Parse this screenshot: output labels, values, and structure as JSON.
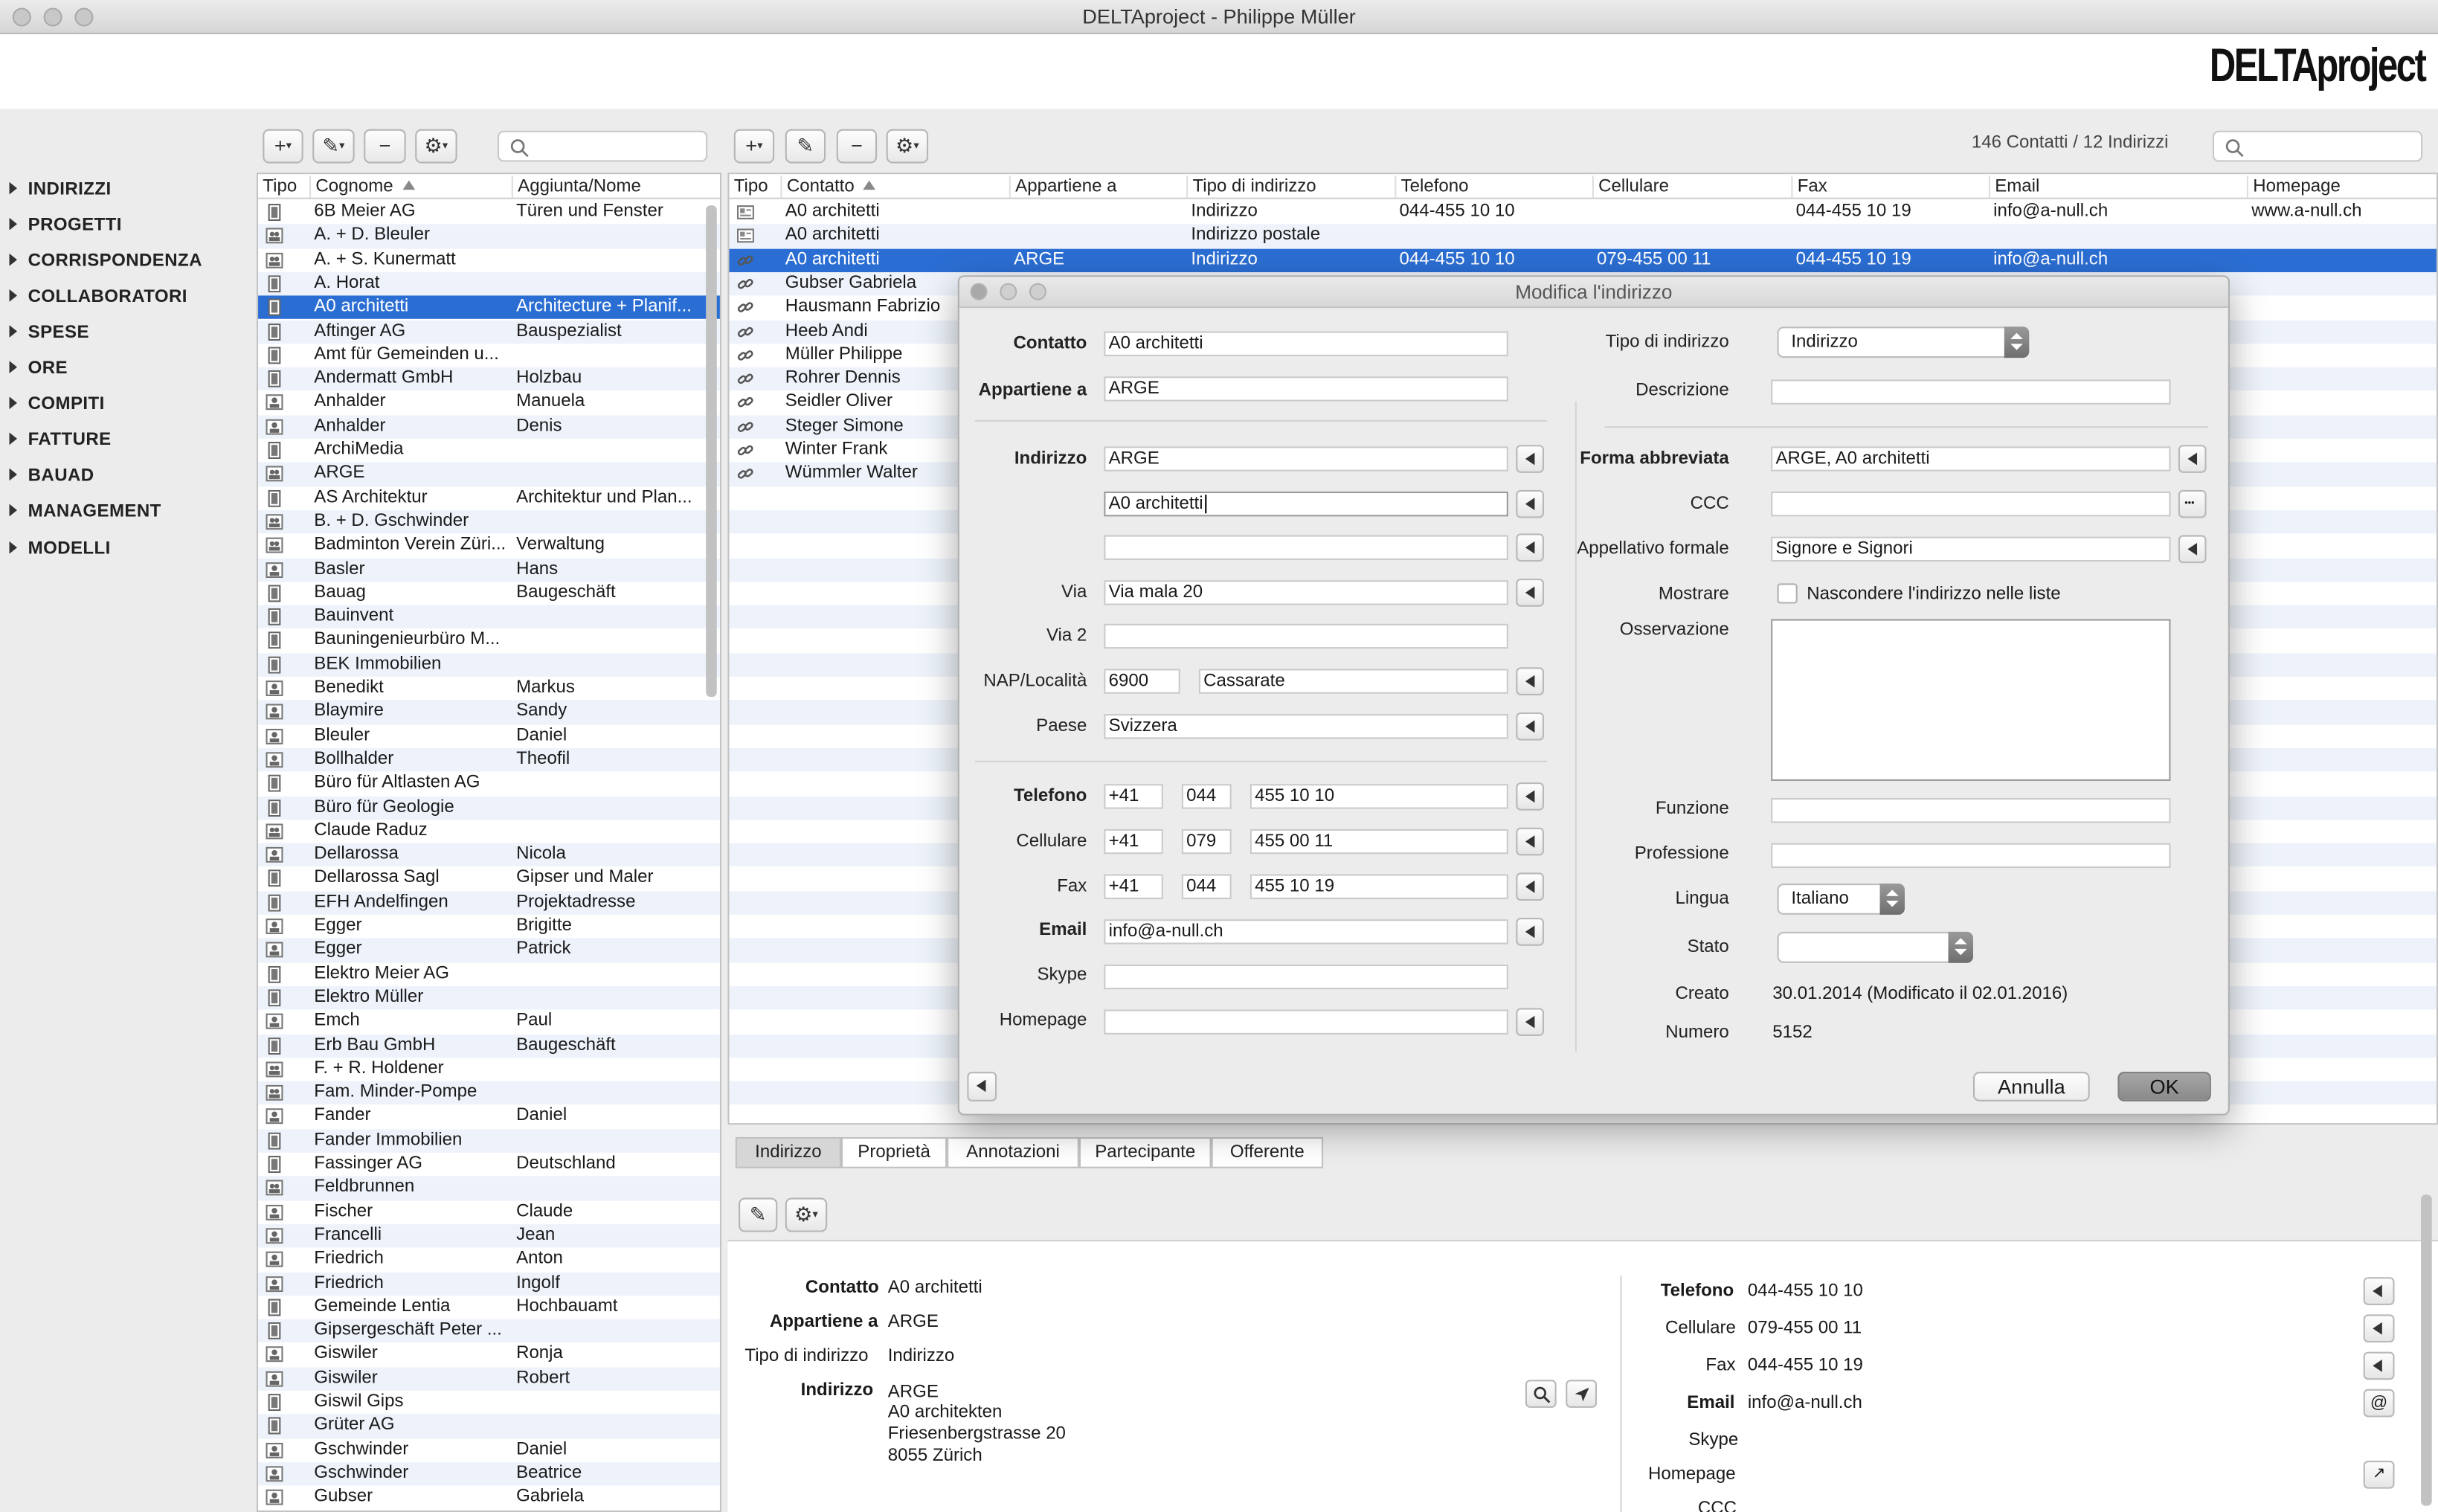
{
  "window": {
    "title": "DELTAproject - Philippe Müller",
    "logo": "DELTAproject"
  },
  "toolbar": {
    "counts": "146 Contatti / 12 Indirizzi",
    "search_left_placeholder": "",
    "search_right_placeholder": ""
  },
  "sidebar": {
    "items": [
      "INDIRIZZI",
      "PROGETTI",
      "CORRISPONDENZA",
      "COLLABORATORI",
      "SPESE",
      "ORE",
      "COMPITI",
      "FATTURE",
      "BAUAD",
      "MANAGEMENT",
      "MODELLI"
    ]
  },
  "left_table": {
    "headers": [
      "Tipo",
      "Cognome",
      "Aggiunta/Nome"
    ],
    "rows": [
      {
        "t": "c",
        "n": "6B Meier AG",
        "a": "Türen und Fenster"
      },
      {
        "t": "g",
        "n": "A. + D. Bleuler",
        "a": ""
      },
      {
        "t": "g",
        "n": "A. + S. Kunermatt",
        "a": ""
      },
      {
        "t": "c",
        "n": "A. Horat",
        "a": ""
      },
      {
        "t": "c",
        "n": "A0 architetti",
        "a": "Architecture + Planif...",
        "sel": true
      },
      {
        "t": "c",
        "n": "Aftinger AG",
        "a": "Bauspezialist"
      },
      {
        "t": "c",
        "n": "Amt für Gemeinden u...",
        "a": ""
      },
      {
        "t": "c",
        "n": "Andermatt GmbH",
        "a": "Holzbau"
      },
      {
        "t": "p",
        "n": "Anhalder",
        "a": "Manuela"
      },
      {
        "t": "p",
        "n": "Anhalder",
        "a": "Denis"
      },
      {
        "t": "c",
        "n": "ArchiMedia",
        "a": ""
      },
      {
        "t": "g",
        "n": "ARGE",
        "a": ""
      },
      {
        "t": "c",
        "n": "AS Architektur",
        "a": "Architektur und Plan..."
      },
      {
        "t": "g",
        "n": "B. + D. Gschwinder",
        "a": ""
      },
      {
        "t": "g",
        "n": "Badminton Verein Züri...",
        "a": "Verwaltung"
      },
      {
        "t": "p",
        "n": "Basler",
        "a": "Hans"
      },
      {
        "t": "c",
        "n": "Bauag",
        "a": "Baugeschäft"
      },
      {
        "t": "c",
        "n": "Bauinvent",
        "a": ""
      },
      {
        "t": "c",
        "n": "Bauningenieurbüro M...",
        "a": ""
      },
      {
        "t": "c",
        "n": "BEK Immobilien",
        "a": ""
      },
      {
        "t": "p",
        "n": "Benedikt",
        "a": "Markus"
      },
      {
        "t": "p",
        "n": "Blaymire",
        "a": "Sandy"
      },
      {
        "t": "p",
        "n": "Bleuler",
        "a": "Daniel"
      },
      {
        "t": "p",
        "n": "Bollhalder",
        "a": "Theofil"
      },
      {
        "t": "c",
        "n": "Büro für Altlasten AG",
        "a": ""
      },
      {
        "t": "c",
        "n": "Büro für Geologie",
        "a": ""
      },
      {
        "t": "g",
        "n": "Claude Raduz",
        "a": ""
      },
      {
        "t": "p",
        "n": "Dellarossa",
        "a": "Nicola"
      },
      {
        "t": "c",
        "n": "Dellarossa Sagl",
        "a": "Gipser und Maler"
      },
      {
        "t": "c",
        "n": "EFH Andelfingen",
        "a": "Projektadresse"
      },
      {
        "t": "p",
        "n": "Egger",
        "a": "Brigitte"
      },
      {
        "t": "p",
        "n": "Egger",
        "a": "Patrick"
      },
      {
        "t": "c",
        "n": "Elektro Meier AG",
        "a": ""
      },
      {
        "t": "c",
        "n": "Elektro Müller",
        "a": ""
      },
      {
        "t": "p",
        "n": "Emch",
        "a": "Paul"
      },
      {
        "t": "c",
        "n": "Erb Bau GmbH",
        "a": "Baugeschäft"
      },
      {
        "t": "g",
        "n": "F. + R. Holdener",
        "a": ""
      },
      {
        "t": "g",
        "n": "Fam. Minder-Pompe",
        "a": ""
      },
      {
        "t": "p",
        "n": "Fander",
        "a": "Daniel"
      },
      {
        "t": "c",
        "n": "Fander Immobilien",
        "a": ""
      },
      {
        "t": "c",
        "n": "Fassinger AG",
        "a": "Deutschland"
      },
      {
        "t": "g",
        "n": "Feldbrunnen",
        "a": ""
      },
      {
        "t": "p",
        "n": "Fischer",
        "a": "Claude"
      },
      {
        "t": "p",
        "n": "Francelli",
        "a": "Jean"
      },
      {
        "t": "p",
        "n": "Friedrich",
        "a": "Anton"
      },
      {
        "t": "p",
        "n": "Friedrich",
        "a": "Ingolf"
      },
      {
        "t": "c",
        "n": "Gemeinde Lentia",
        "a": "Hochbauamt"
      },
      {
        "t": "c",
        "n": "Gipsergeschäft Peter ...",
        "a": ""
      },
      {
        "t": "p",
        "n": "Giswiler",
        "a": "Ronja"
      },
      {
        "t": "p",
        "n": "Giswiler",
        "a": "Robert"
      },
      {
        "t": "c",
        "n": "Giswil Gips",
        "a": ""
      },
      {
        "t": "c",
        "n": "Grüter AG",
        "a": ""
      },
      {
        "t": "p",
        "n": "Gschwinder",
        "a": "Daniel"
      },
      {
        "t": "p",
        "n": "Gschwinder",
        "a": "Beatrice"
      },
      {
        "t": "p",
        "n": "Gubser",
        "a": "Gabriela"
      }
    ]
  },
  "right_table": {
    "headers": [
      "Tipo",
      "Contatto",
      "Appartiene a",
      "Tipo di indirizzo",
      "Telefono",
      "Cellulare",
      "Fax",
      "Email",
      "Homepage"
    ],
    "rows": [
      {
        "t": "card",
        "c": "A0 architetti",
        "ap": "",
        "ti": "Indirizzo",
        "tel": "044-455 10 10",
        "cel": "",
        "fax": "044-455 10 19",
        "em": "info@a-null.ch",
        "hp": "www.a-null.ch"
      },
      {
        "t": "card",
        "c": "A0 architetti",
        "ap": "",
        "ti": "Indirizzo postale",
        "tel": "",
        "cel": "",
        "fax": "",
        "em": "",
        "hp": ""
      },
      {
        "t": "link",
        "c": "A0 architetti",
        "ap": "ARGE",
        "ti": "Indirizzo",
        "tel": "044-455 10 10",
        "cel": "079-455 00 11",
        "fax": "044-455 10 19",
        "em": "info@a-null.ch",
        "hp": "",
        "sel": true
      },
      {
        "t": "link",
        "c": "Gubser Gabriela"
      },
      {
        "t": "link",
        "c": "Hausmann Fabrizio"
      },
      {
        "t": "link",
        "c": "Heeb Andi"
      },
      {
        "t": "link",
        "c": "Müller Philippe"
      },
      {
        "t": "link",
        "c": "Rohrer Dennis"
      },
      {
        "t": "link",
        "c": "Seidler Oliver"
      },
      {
        "t": "link",
        "c": "Steger Simone"
      },
      {
        "t": "link",
        "c": "Winter Frank"
      },
      {
        "t": "link",
        "c": "Wümmler Walter"
      }
    ]
  },
  "dialog": {
    "title": "Modifica l'indirizzo",
    "labels": {
      "contatto": "Contatto",
      "appartiene": "Appartiene a",
      "indirizzo": "Indirizzo",
      "via": "Via",
      "via2": "Via 2",
      "nap": "NAP/Località",
      "paese": "Paese",
      "telefono": "Telefono",
      "cellulare": "Cellulare",
      "fax": "Fax",
      "email": "Email",
      "skype": "Skype",
      "homepage": "Homepage",
      "tipo": "Tipo di indirizzo",
      "descrizione": "Descrizione",
      "forma": "Forma abbreviata",
      "ccc": "CCC",
      "appellativo": "Appellativo formale",
      "mostrare": "Mostrare",
      "osservazione": "Osservazione",
      "funzione": "Funzione",
      "professione": "Professione",
      "lingua": "Lingua",
      "stato": "Stato",
      "creato": "Creato",
      "numero": "Numero"
    },
    "values": {
      "contatto": "A0 architetti",
      "appartiene": "ARGE",
      "ind1": "ARGE",
      "ind2": "A0 architetti",
      "ind3": "",
      "via": "Via mala 20",
      "via2": "",
      "nap": "6900",
      "localita": "Cassarate",
      "paese": "Svizzera",
      "tel_cc": "+41",
      "tel_area": "044",
      "tel_num": "455 10 10",
      "cel_cc": "+41",
      "cel_area": "079",
      "cel_num": "455 00 11",
      "fax_cc": "+41",
      "fax_area": "044",
      "fax_num": "455 10 19",
      "email": "info@a-null.ch",
      "skype": "",
      "homepage": "",
      "tipo": "Indirizzo",
      "descrizione": "",
      "forma": "ARGE, A0 architetti",
      "ccc": "",
      "appellativo": "Signore e Signori",
      "nascondere": "Nascondere l'indirizzo nelle liste",
      "osservazione": "",
      "funzione": "",
      "professione": "",
      "lingua": "Italiano",
      "stato": "",
      "creato": "30.01.2014 (Modificato il 02.01.2016)",
      "numero": "5152"
    },
    "buttons": {
      "cancel": "Annulla",
      "ok": "OK"
    }
  },
  "tabs": [
    "Indirizzo",
    "Proprietà",
    "Annotazioni",
    "Partecipante",
    "Offerente"
  ],
  "detail": {
    "labels": {
      "contatto": "Contatto",
      "appartiene": "Appartiene a",
      "tipo": "Tipo di indirizzo",
      "indirizzo": "Indirizzo",
      "telefono": "Telefono",
      "cellulare": "Cellulare",
      "fax": "Fax",
      "email": "Email",
      "skype": "Skype",
      "homepage": "Homepage",
      "ccc": "CCC"
    },
    "values": {
      "contatto": "A0 architetti",
      "appartiene": "ARGE",
      "tipo": "Indirizzo",
      "addr1": "ARGE",
      "addr2": "A0 architekten",
      "addr3": "Friesenbergstrasse 20",
      "addr4": "8055 Zürich",
      "telefono": "044-455 10 10",
      "cellulare": "079-455 00 11",
      "fax": "044-455 10 19",
      "email": "info@a-null.ch"
    }
  }
}
